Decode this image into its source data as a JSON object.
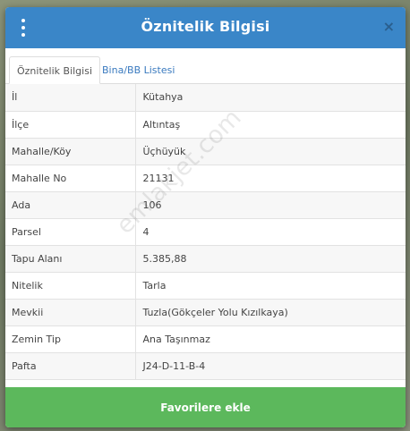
{
  "header": {
    "title": "Öznitelik Bilgisi",
    "close_label": "×"
  },
  "tabs": [
    {
      "label": "Öznitelik Bilgisi",
      "active": true
    },
    {
      "label": "Bina/BB Listesi",
      "active": false
    }
  ],
  "rows": [
    {
      "key": "İl",
      "value": "Kütahya"
    },
    {
      "key": "İlçe",
      "value": "Altıntaş"
    },
    {
      "key": "Mahalle/Köy",
      "value": "Üçhüyük"
    },
    {
      "key": "Mahalle No",
      "value": "21131"
    },
    {
      "key": "Ada",
      "value": "106"
    },
    {
      "key": "Parsel",
      "value": "4"
    },
    {
      "key": "Tapu Alanı",
      "value": "5.385,88"
    },
    {
      "key": "Nitelik",
      "value": "Tarla"
    },
    {
      "key": "Mevkii",
      "value": "Tuzla(Gökçeler Yolu Kızılkaya)"
    },
    {
      "key": "Zemin Tip",
      "value": "Ana Taşınmaz"
    },
    {
      "key": "Pafta",
      "value": "J24-D-11-B-4"
    }
  ],
  "favorite_button": "Favorilere ekle",
  "watermark": "emlakjet.com",
  "colors": {
    "header": "#3a86c8",
    "button": "#5cb85c",
    "tab_link": "#3a7abf"
  }
}
